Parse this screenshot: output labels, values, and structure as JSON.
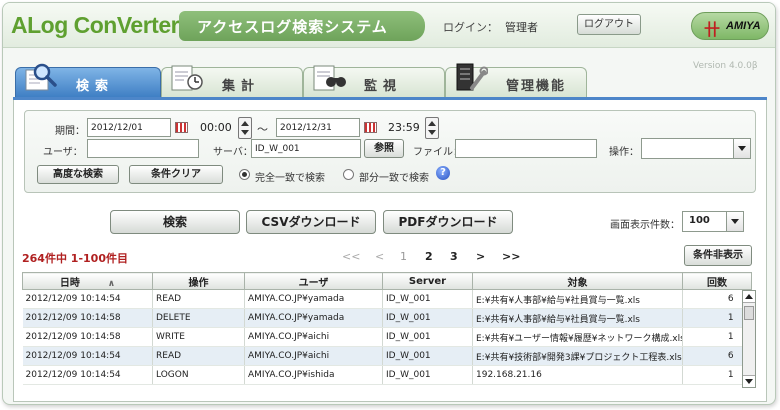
{
  "header": {
    "logo": "ALog ConVerter",
    "logo_mark": "®",
    "title": "アクセスログ検索システム",
    "login_label": "ログイン：",
    "login_user": "管理者",
    "logout_label": "ログアウト",
    "brand": "AMIYA",
    "brand_mark": "卄"
  },
  "version": "Version 4.0.0β",
  "tabs": [
    {
      "label": "検索",
      "icon": "magnifier-icon",
      "active": true
    },
    {
      "label": "集計",
      "icon": "report-clock-icon",
      "active": false
    },
    {
      "label": "監視",
      "icon": "binoculars-icon",
      "active": false
    },
    {
      "label": "管理機能",
      "icon": "server-tool-icon",
      "active": false
    }
  ],
  "search": {
    "period_label": "期間：",
    "date_from": "2012/12/01",
    "time_from": "00:00",
    "tilde": "〜",
    "date_to": "2012/12/31",
    "time_to": "23:59",
    "user_label": "ユーザ：",
    "user_value": "",
    "server_label": "サーバ：",
    "server_value": "ID_W_001",
    "browse_label": "参照",
    "file_label": "ファイル：",
    "file_value": "",
    "operation_label": "操作：",
    "operation_value": "",
    "advanced_label": "高度な検索",
    "clear_label": "条件クリア",
    "match_exact": "完全一致で検索",
    "match_partial": "部分一致で検索",
    "help": "?"
  },
  "actions": {
    "search": "検索",
    "csv": "CSVダウンロード",
    "pdf": "PDFダウンロード",
    "per_page_label": "画面表示件数：",
    "per_page_value": "100",
    "hide_criteria": "条件非表示"
  },
  "results": {
    "count_text": "264件中 1-100件目",
    "pager": {
      "first": "<<",
      "prev": "<",
      "pages": [
        "1",
        "2",
        "3"
      ],
      "next": ">",
      "last": ">>"
    },
    "columns": [
      "日時",
      "操作",
      "ユーザ",
      "Server",
      "対象",
      "回数"
    ],
    "sort_caret": "∧",
    "rows": [
      [
        "2012/12/09 10:14:54",
        "READ",
        "AMIYA.CO.JP¥yamada",
        "ID_W_001",
        "E:¥共有¥人事部¥給与¥社員賞与一覧.xls",
        "6"
      ],
      [
        "2012/12/09 10:14:58",
        "DELETE",
        "AMIYA.CO.JP¥yamada",
        "ID_W_001",
        "E:¥共有¥人事部¥給与¥社員賞与一覧.xls",
        "1"
      ],
      [
        "2012/12/09 10:14:58",
        "WRITE",
        "AMIYA.CO.JP¥aichi",
        "ID_W_001",
        "E:¥共有¥ユーザー情報¥履歴¥ネットワーク構成.xls",
        "1"
      ],
      [
        "2012/12/09 10:14:54",
        "READ",
        "AMIYA.CO.JP¥aichi",
        "ID_W_001",
        "E:¥共有¥技術部¥開発3課¥プロジェクト工程表.xls",
        "6"
      ],
      [
        "2012/12/09 10:14:54",
        "LOGON",
        "AMIYA.CO.JP¥ishida",
        "ID_W_001",
        "192.168.21.16",
        "1"
      ]
    ]
  },
  "colors": {
    "brand_green": "#5fa030",
    "active_tab": "#3f7fc4",
    "count_red": "#b02020",
    "row_alt": "#e6eef5"
  }
}
